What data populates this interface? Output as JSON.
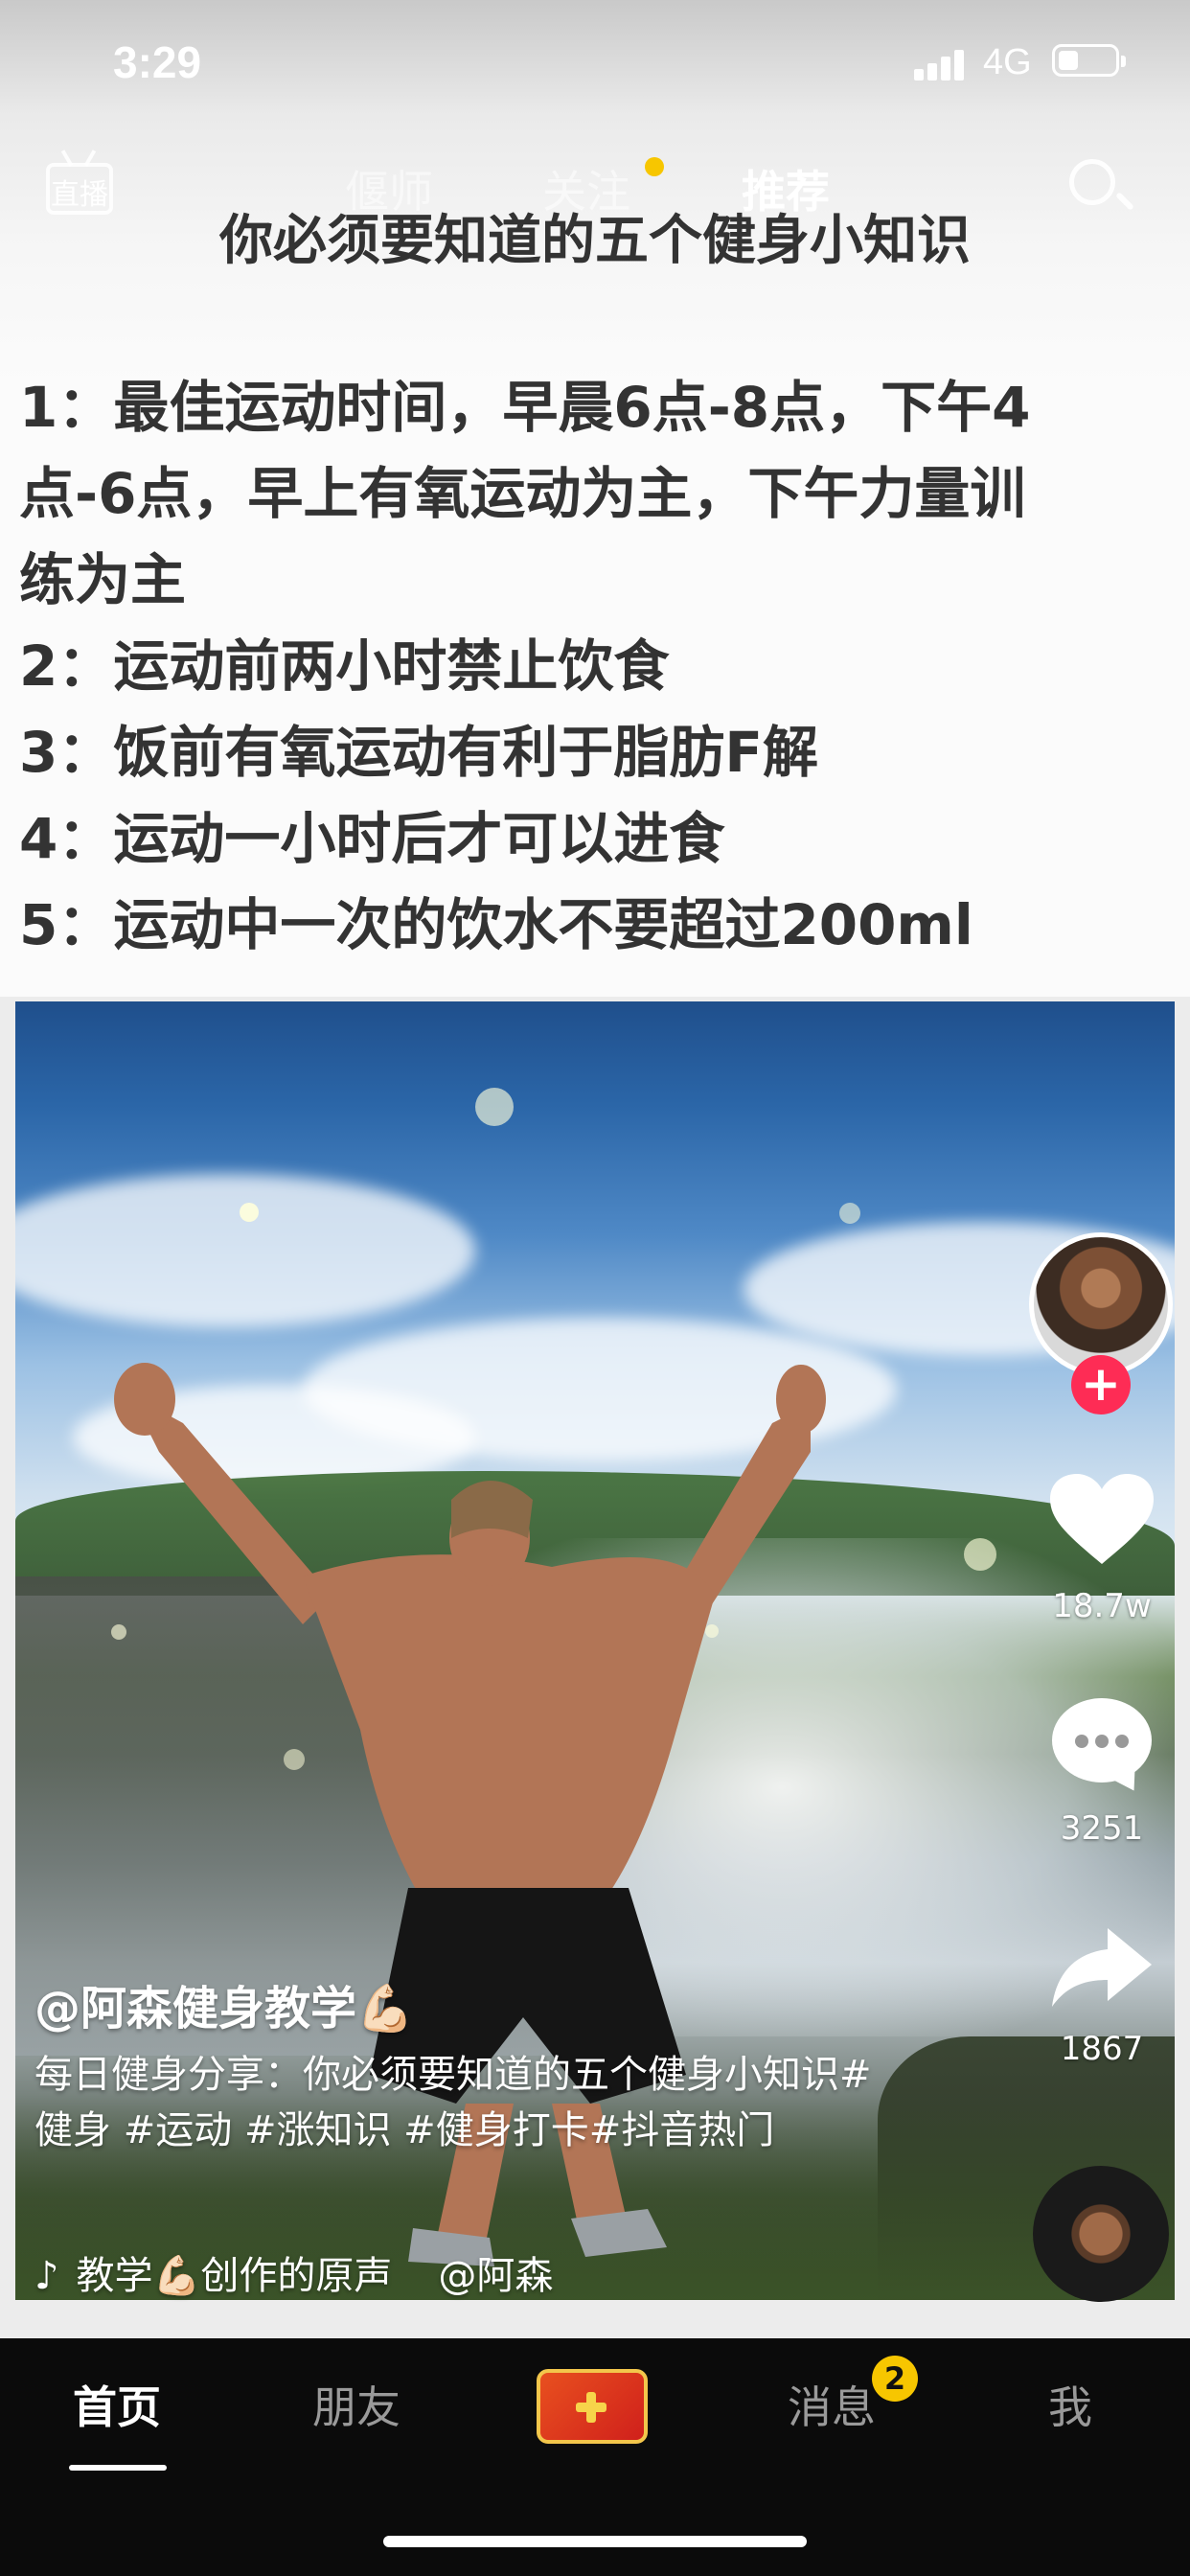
{
  "status_bar": {
    "time": "3:29",
    "network": "4G"
  },
  "top_nav": {
    "live_label": "直播",
    "tabs": [
      {
        "label": "偃师"
      },
      {
        "label": "关注"
      },
      {
        "label": "推荐"
      }
    ]
  },
  "article": {
    "title": "你必须要知道的五个健身小知识",
    "lines": [
      "1：最佳运动时间，早晨6点-8点，下午4",
      "点-6点，早上有氧运动为主，下午力量训",
      "练为主",
      "2：运动前两小时禁止饮食",
      "3：饭前有氧运动有利于脂肪F解",
      "4：运动一小时后才可以进食",
      "5：运动中一次的饮水不要超过200ml"
    ]
  },
  "video": {
    "creator": "@阿森健身教学💪🏻",
    "caption": "每日健身分享：你必须要知道的五个健身小知识#健身 #运动 #涨知识 #健身打卡#抖音热门",
    "music": "教学💪🏻创作的原声",
    "music_author": "@阿森"
  },
  "rail": {
    "likes": "18.7w",
    "comments": "3251",
    "shares": "1867",
    "follow_symbol": "+"
  },
  "tab_bar": {
    "tabs": [
      {
        "label": "首页"
      },
      {
        "label": "朋友"
      },
      {
        "label": "消息"
      },
      {
        "label": "我"
      }
    ],
    "messages_badge": "2"
  }
}
